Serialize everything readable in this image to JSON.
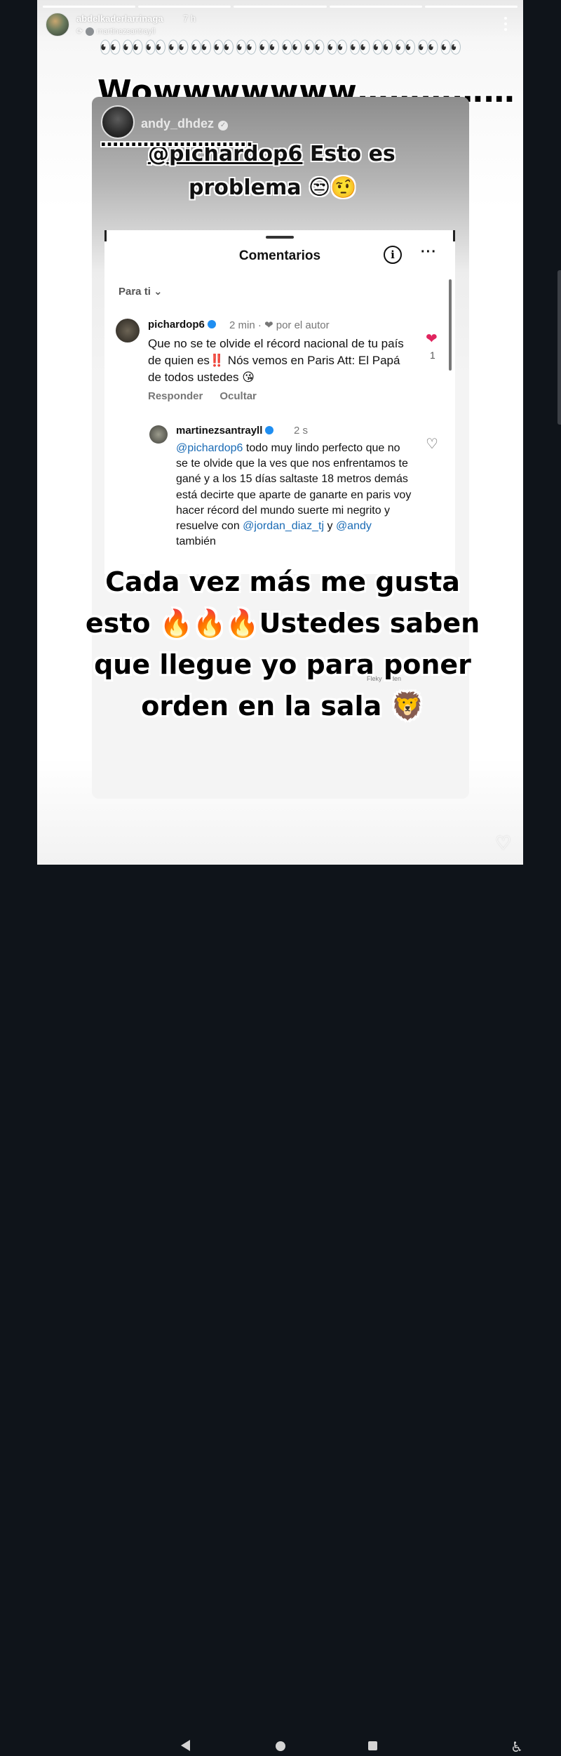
{
  "story": {
    "username": "abdelkaderlarrinaga",
    "time": "7 h",
    "shared_from": "martinezsantrayll",
    "progress_segments": 5,
    "progress_done": 5,
    "eyes": "👀👀👀👀👀👀👀👀👀👀👀👀👀👀👀👀",
    "wow_text": "Wowwwwwww……………",
    "wow_dots": "…………………….",
    "bottom_text": "Cada vez más me gusta esto 🔥🔥🔥Ustedes saben que llegue yo para poner orden en la sala 🦁",
    "faded_label": "Fleky Orden"
  },
  "repost": {
    "username": "andy_dhdez",
    "mention": "@pichardop6",
    "caption_rest": " Esto es",
    "caption_line2": "problema 😒🤨"
  },
  "comments_panel": {
    "title": "Comentarios",
    "filter": "Para ti",
    "comments": [
      {
        "user": "pichardop6",
        "meta": "2 min · ❤ por el autor",
        "text": "Que no se te olvide el récord nacional de tu país de quien es‼️ Nós vemos en Paris Att: El Papá de todos ustedes 😘",
        "reply": "Responder",
        "hide": "Ocultar",
        "likes": "1"
      },
      {
        "user": "martinezsantrayll",
        "meta": "2 s",
        "mention1": "@pichardop6",
        "text": " todo muy lindo perfecto que no se te olvide que la ves que nos enfrentamos te gané y a los 15 días saltaste 18 metros demás está decirte que aparte de ganarte en paris voy hacer récord del mundo suerte mi negrito y resuelve con ",
        "mention2": "@jordan_diaz_tj",
        "text_mid": " y ",
        "mention3": "@andy",
        "text_end": " también"
      }
    ]
  },
  "icons": {
    "more": "more-vertical-icon",
    "like": "heart-outline-icon",
    "info": "info-icon",
    "nav_back": "back-triangle-icon",
    "nav_home": "home-circle-icon",
    "nav_recent": "recents-square-icon",
    "accessibility": "accessibility-icon"
  }
}
